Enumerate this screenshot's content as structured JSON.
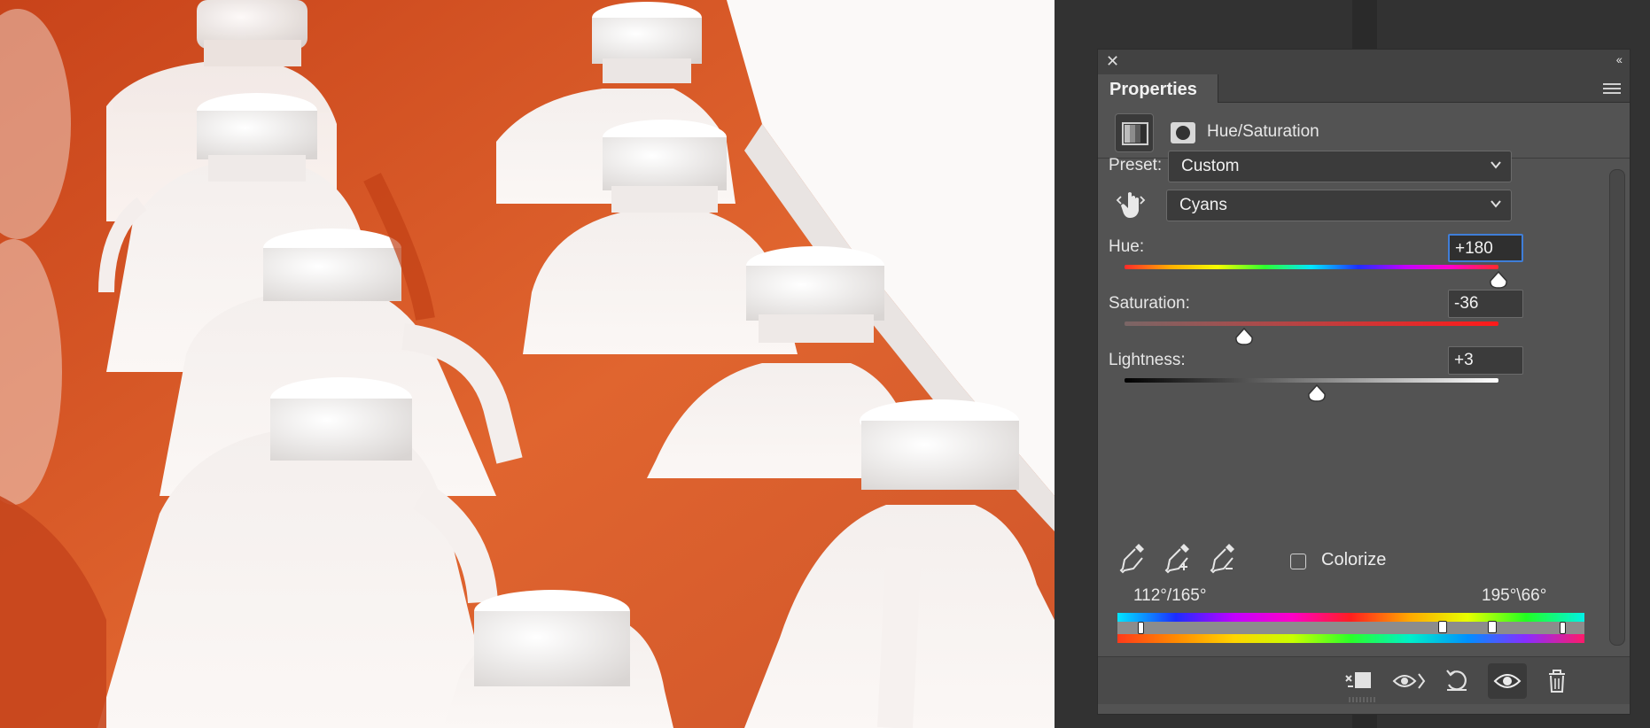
{
  "panel": {
    "tab_label": "Properties",
    "adjustment_title": "Hue/Saturation",
    "preset": {
      "label": "Preset:",
      "value": "Custom"
    },
    "range": {
      "value": "Cyans"
    },
    "hue": {
      "label": "Hue:",
      "value": "+180",
      "fraction": 1.0
    },
    "saturation": {
      "label": "Saturation:",
      "value": "-36",
      "fraction": 0.32
    },
    "lightness": {
      "label": "Lightness:",
      "value": "+3",
      "fraction": 0.515
    },
    "colorize": {
      "label": "Colorize",
      "checked": false
    },
    "range_left_readout": "112°/165°",
    "range_right_readout": "195°\\66°"
  },
  "icons": {
    "close": "close-icon",
    "collapse": "double-chevron-left-icon",
    "menu": "panel-menu-icon",
    "adjustment": "hue-saturation-layer-icon",
    "mask": "layer-mask-icon",
    "targeted_adjust": "hand-scrubby-icon",
    "eyedroppers": [
      "eyedropper-icon",
      "eyedropper-plus-icon",
      "eyedropper-minus-icon"
    ],
    "footer": [
      "clip-to-layer-icon",
      "view-previous-state-icon",
      "reset-icon",
      "visibility-eye-icon",
      "delete-trash-icon"
    ]
  },
  "colors": {
    "panel_bg": "#535353",
    "focus_ring": "#3f7ed8",
    "photo_orange": "#d9542a"
  }
}
